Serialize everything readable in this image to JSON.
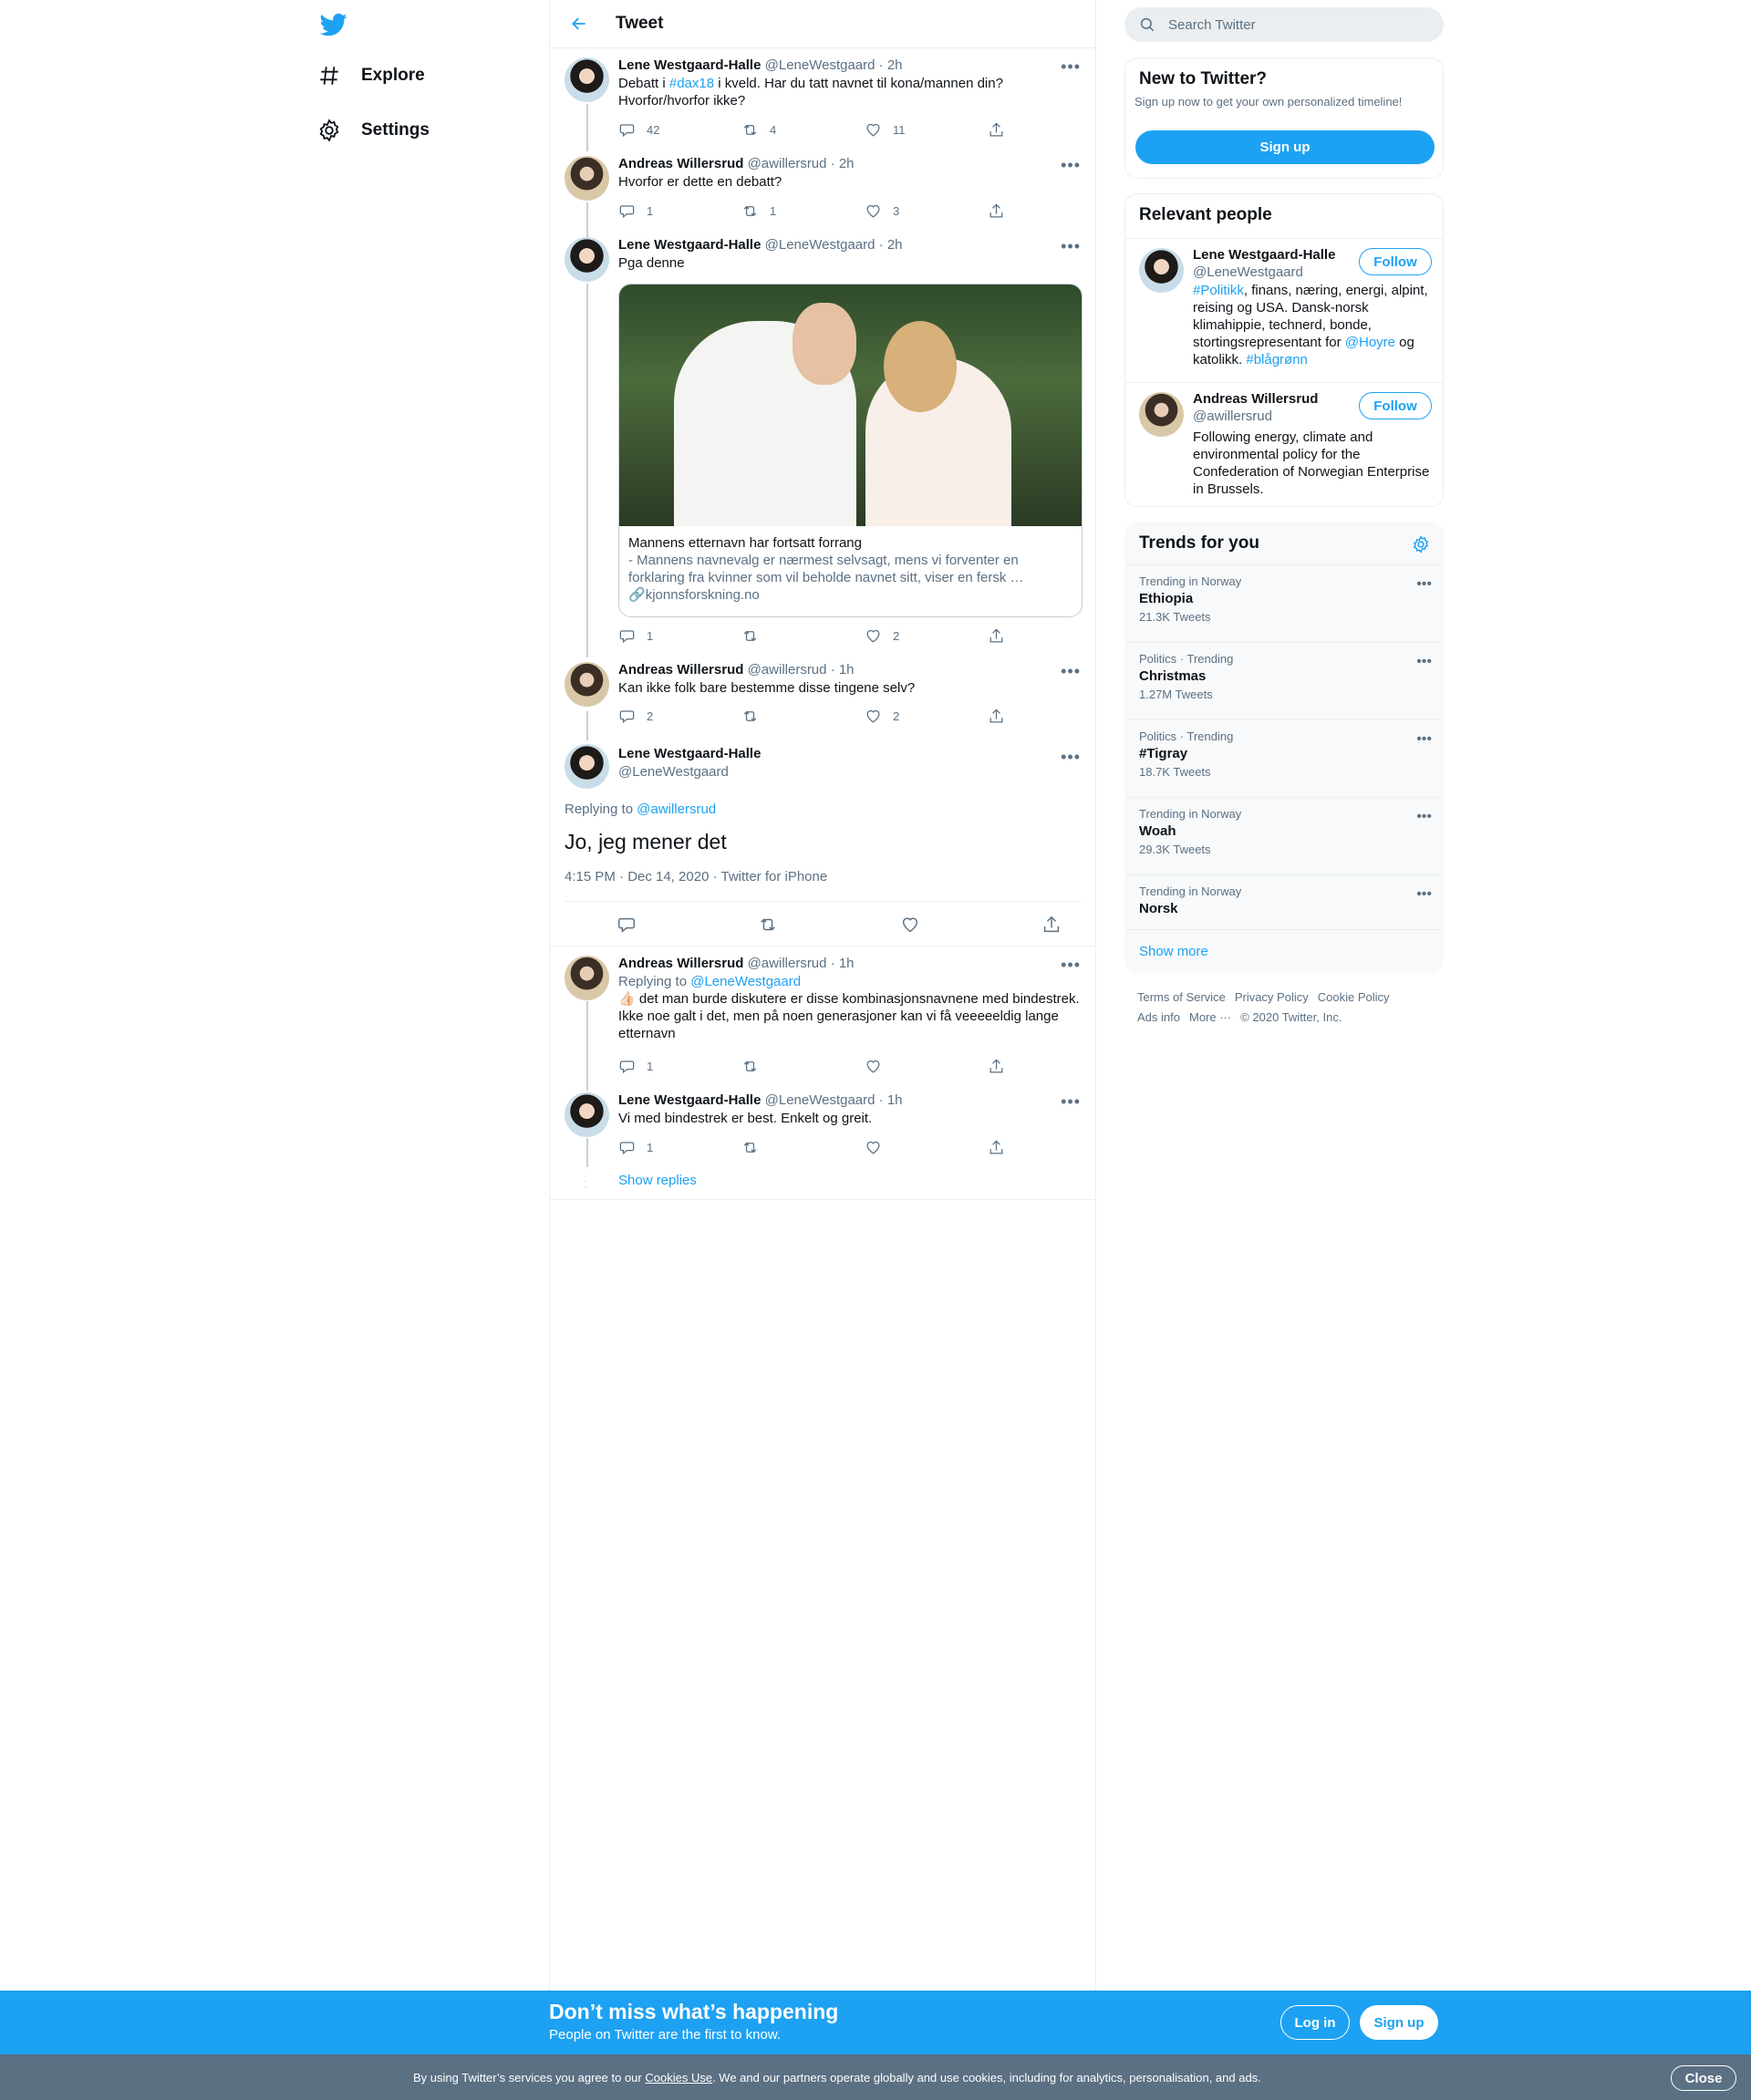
{
  "nav": {
    "explore": "Explore",
    "settings": "Settings"
  },
  "header": {
    "title": "Tweet"
  },
  "tweets": [
    {
      "name": "Lene Westgaard-Halle",
      "handle": "@LeneWestgaard",
      "time": "· 2h",
      "text_pre": "Debatt i ",
      "hashtag": "#dax18",
      "text_post": " i kveld. Har du tatt navnet til kona/mannen din?",
      "text_line2": "Hvorfor/hvorfor ikke?",
      "replies": "42",
      "retweets": "4",
      "likes": "11"
    },
    {
      "name": "Andreas Willersrud",
      "handle": "@awillersrud",
      "time": "· 2h",
      "text": "Hvorfor er dette en debatt?",
      "replies": "1",
      "retweets": "1",
      "likes": "3"
    },
    {
      "name": "Lene Westgaard-Halle",
      "handle": "@LeneWestgaard",
      "time": "· 2h",
      "text": "Pga denne",
      "card": {
        "title": "Mannens etternavn har fortsatt forrang",
        "description": "- Mannens navnevalg er nærmest selvsagt, mens vi forventer en forklaring fra kvinner som vil beholde navnet sitt, viser en fersk …",
        "domain": "kjonnsforskning.no"
      },
      "replies": "1",
      "retweets": "",
      "likes": "2"
    },
    {
      "name": "Andreas Willersrud",
      "handle": "@awillersrud",
      "time": "· 1h",
      "text": "Kan ikke folk bare bestemme disse tingene selv?",
      "replies": "2",
      "retweets": "",
      "likes": "2"
    }
  ],
  "focus": {
    "name": "Lene Westgaard-Halle",
    "handle": "@LeneWestgaard",
    "replying_prefix": "Replying to",
    "replying_to": "@awillersrud",
    "text": "Jo, jeg mener det",
    "meta": "4:15 PM · Dec 14, 2020 · Twitter for iPhone"
  },
  "replies": [
    {
      "name": "Andreas Willersrud",
      "handle": "@awillersrud",
      "time": "· 1h",
      "replying_prefix": "Replying to",
      "replying_to": "@LeneWestgaard",
      "emoji": "👍🏻",
      "text": " det man burde diskutere er disse kombinasjonsnavnene med bindestrek. Ikke noe galt i det, men på noen generasjoner kan vi få veeeeeldig lange etternavn",
      "replies": "1"
    },
    {
      "name": "Lene Westgaard-Halle",
      "handle": "@LeneWestgaard",
      "time": "· 1h",
      "text": "Vi med bindestrek er best. Enkelt og greit.",
      "replies": "1"
    }
  ],
  "show_replies": "Show replies",
  "search": {
    "placeholder": "Search Twitter"
  },
  "new_box": {
    "title": "New to Twitter?",
    "subtitle": "Sign up now to get your own personalized timeline!",
    "button": "Sign up"
  },
  "relevant": {
    "title": "Relevant people",
    "people": [
      {
        "name": "Lene Westgaard-Halle",
        "handle": "@LeneWestgaard",
        "follow": "Follow",
        "bio_tag1": "#Politikk",
        "bio_mid": ", finans, næring, energi, alpint, reising og USA. Dansk-norsk klimahippie, technerd, bonde, stortingsrepresentant for ",
        "bio_mention": "@Hoyre",
        "bio_og": " og katolikk. ",
        "bio_tag2": "#blågrønn"
      },
      {
        "name": "Andreas Willersrud",
        "handle": "@awillersrud",
        "follow": "Follow",
        "bio": "Following energy, climate and environmental policy for the Confederation of Norwegian Enterprise in Brussels."
      }
    ]
  },
  "trends": {
    "title": "Trends for you",
    "items": [
      {
        "context": "Trending in Norway",
        "name": "Ethiopia",
        "count": "21.3K Tweets"
      },
      {
        "context": "Politics · Trending",
        "name": "Christmas",
        "count": "1.27M Tweets"
      },
      {
        "context": "Politics · Trending",
        "name": "#Tigray",
        "count": "18.7K Tweets"
      },
      {
        "context": "Trending in Norway",
        "name": "Woah",
        "count": "29.3K Tweets"
      },
      {
        "context": "Trending in Norway",
        "name": "Norsk",
        "count": ""
      }
    ],
    "show_more": "Show more"
  },
  "footer": {
    "terms": "Terms of Service",
    "privacy": "Privacy Policy",
    "cookie": "Cookie Policy",
    "ads": "Ads info",
    "more": "More ···",
    "copyright": "© 2020 Twitter, Inc."
  },
  "banner": {
    "headline": "Don’t miss what’s happening",
    "sub": "People on Twitter are the first to know.",
    "login": "Log in",
    "signup": "Sign up"
  },
  "cookie_bar": {
    "pre": "By using Twitter’s services you agree to our ",
    "link": "Cookies Use",
    "post": ". We and our partners operate globally and use cookies, including for analytics, personalisation, and ads.",
    "close": "Close"
  },
  "colors": {
    "accent": "#1da1f2",
    "text": "#0f1419",
    "secondary": "#5b7083",
    "border": "#ebeef0"
  }
}
